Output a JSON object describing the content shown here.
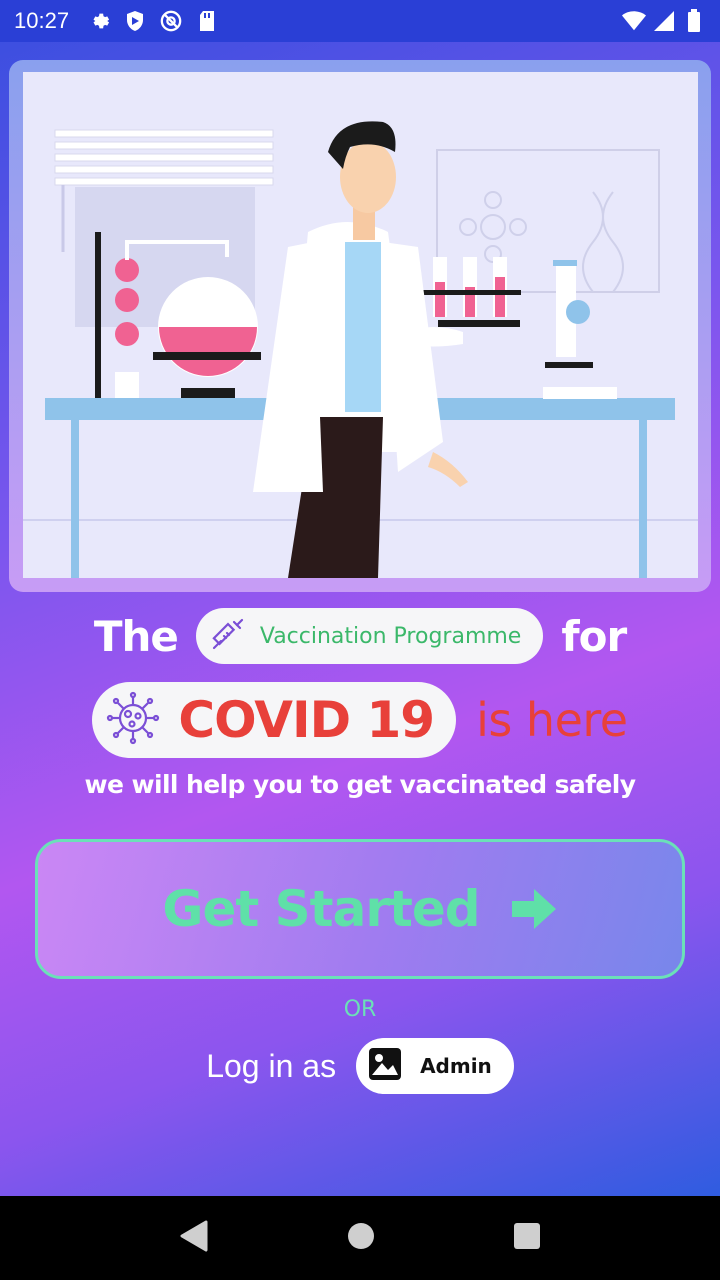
{
  "status_bar": {
    "time": "10:27",
    "left_icons": [
      "gear-icon",
      "shield-icon",
      "at-sign-icon",
      "sd-card-icon"
    ],
    "right_icons": [
      "wifi-icon",
      "signal-icon",
      "battery-icon"
    ]
  },
  "illustration": {
    "subject": "scientist-in-lab-icon"
  },
  "headline": {
    "word_the": "The",
    "vaccination_label": "Vaccination Programme",
    "word_for": "for",
    "covid_label": "COVID 19",
    "is_here": "is here"
  },
  "subtitle": "we will help you to get vaccinated safely",
  "cta": {
    "get_started_label": "Get Started"
  },
  "or_label": "OR",
  "login": {
    "label": "Log in as",
    "admin_label": "Admin"
  },
  "colors": {
    "accent_green": "#5fe0a8",
    "covid_red": "#e8403a",
    "vacc_green": "#3bb86a"
  }
}
